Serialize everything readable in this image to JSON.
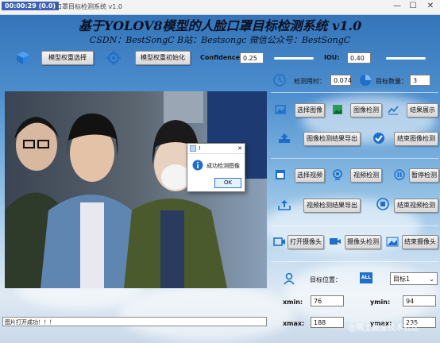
{
  "window": {
    "title_stamp": "00:00:29 (0.0)",
    "title": "口罩目标检测系统 v1.0",
    "controls": {
      "minimize": "—",
      "maximize": "☐",
      "close": "✕"
    }
  },
  "header": {
    "title": "基于YOLOV8模型的人脸口罩目标检测系统 v1.0",
    "subtitle": "CSDN：BestSongC   B站：Bestsongc   微信公众号：BestSongC"
  },
  "toolbar": {
    "model_select_label": "模型权重选择",
    "model_init_label": "模型权重初始化",
    "confidence_label": "Confidence:",
    "confidence_value": "0.25",
    "iou_label": "IOU:",
    "iou_value": "0.40"
  },
  "stats": {
    "time_label": "检测用时：",
    "time_value": "0.074",
    "count_label": "目标数量：",
    "count_value": "3"
  },
  "image_controls": {
    "select_label": "选择图像",
    "detect_label": "图像检测",
    "show_label": "结果展示",
    "export_label": "图像检测结果导出",
    "finish_label": "结束图像检测"
  },
  "video_controls": {
    "select_label": "选择视频",
    "detect_label": "视频检测",
    "pause_label": "暂停检测",
    "export_label": "视频检测结果导出",
    "finish_label": "结束视频检测"
  },
  "camera_controls": {
    "open_label": "打开摄像头",
    "detect_label": "摄像头检测",
    "finish_label": "结束摄像头"
  },
  "target": {
    "position_label": "目标位置：",
    "all_badge": "ALL",
    "selected_target": "目标1",
    "xmin_label": "xmin:",
    "xmin_value": "76",
    "ymin_label": "ymin:",
    "ymin_value": "94",
    "xmax_label": "xmax:",
    "xmax_value": "188",
    "ymax_label": "ymax:",
    "ymax_value": "235"
  },
  "dialog": {
    "title": "!",
    "message": "成功检测图像",
    "ok_label": "OK",
    "close": "✕"
  },
  "status_bar": {
    "text": "图片打开成功！！！"
  },
  "watermark": "@稀土掘金技术社区",
  "colors": {
    "accent": "#2f7bd6",
    "background_top": "#2f6fb5"
  }
}
